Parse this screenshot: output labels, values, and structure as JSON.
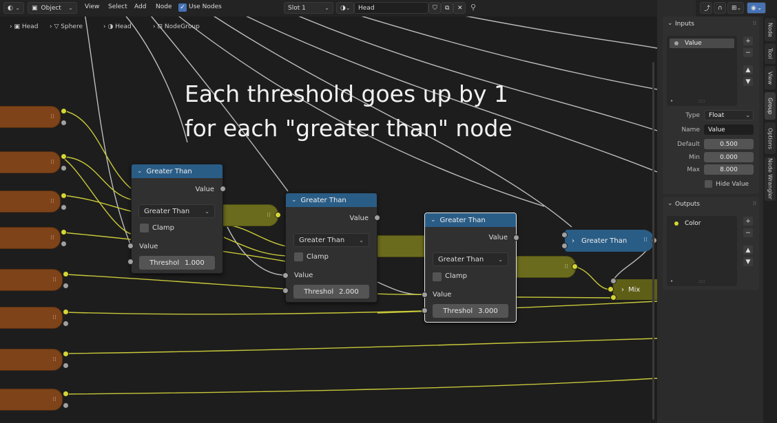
{
  "header": {
    "mode": "Object",
    "menus": [
      "View",
      "Select",
      "Add",
      "Node"
    ],
    "use_nodes_label": "Use Nodes",
    "slot": "Slot 1",
    "material": "Head"
  },
  "breadcrumbs": [
    "Head",
    "Sphere",
    "Head",
    "NodeGroup"
  ],
  "annotation": {
    "line1": "Each threshold goes up by 1",
    "line2": "for each \"greater than\" node"
  },
  "nodes": [
    {
      "title": "Greater Than",
      "out_label": "Value",
      "op": "Greater Than",
      "clamp": "Clamp",
      "in_label": "Value",
      "threshold_label": "Threshol",
      "threshold": "1.000"
    },
    {
      "title": "Greater Than",
      "out_label": "Value",
      "op": "Greater Than",
      "clamp": "Clamp",
      "in_label": "Value",
      "threshold_label": "Threshol",
      "threshold": "2.000"
    },
    {
      "title": "Greater Than",
      "out_label": "Value",
      "op": "Greater Than",
      "clamp": "Clamp",
      "in_label": "Value",
      "threshold_label": "Threshol",
      "threshold": "3.000"
    }
  ],
  "group_node": {
    "title": "Greater Than"
  },
  "mix_node": {
    "title": "Mix"
  },
  "sidebar": {
    "tabs": [
      "Node",
      "Tool",
      "View",
      "Group",
      "Options",
      "Node Wrangler"
    ],
    "inputs": {
      "title": "Inputs",
      "item": "Value",
      "type_label": "Type",
      "type": "Float",
      "name_label": "Name",
      "name": "Value",
      "default_label": "Default",
      "default": "0.500",
      "min_label": "Min",
      "min": "0.000",
      "max_label": "Max",
      "max": "8.000",
      "hide_value": "Hide Value"
    },
    "outputs": {
      "title": "Outputs",
      "item": "Color"
    }
  },
  "colors": {
    "accent": "#2a5d86",
    "frame": "#7e4319",
    "wire": "#c8c83a",
    "socket_yellow": "#d6d633"
  }
}
